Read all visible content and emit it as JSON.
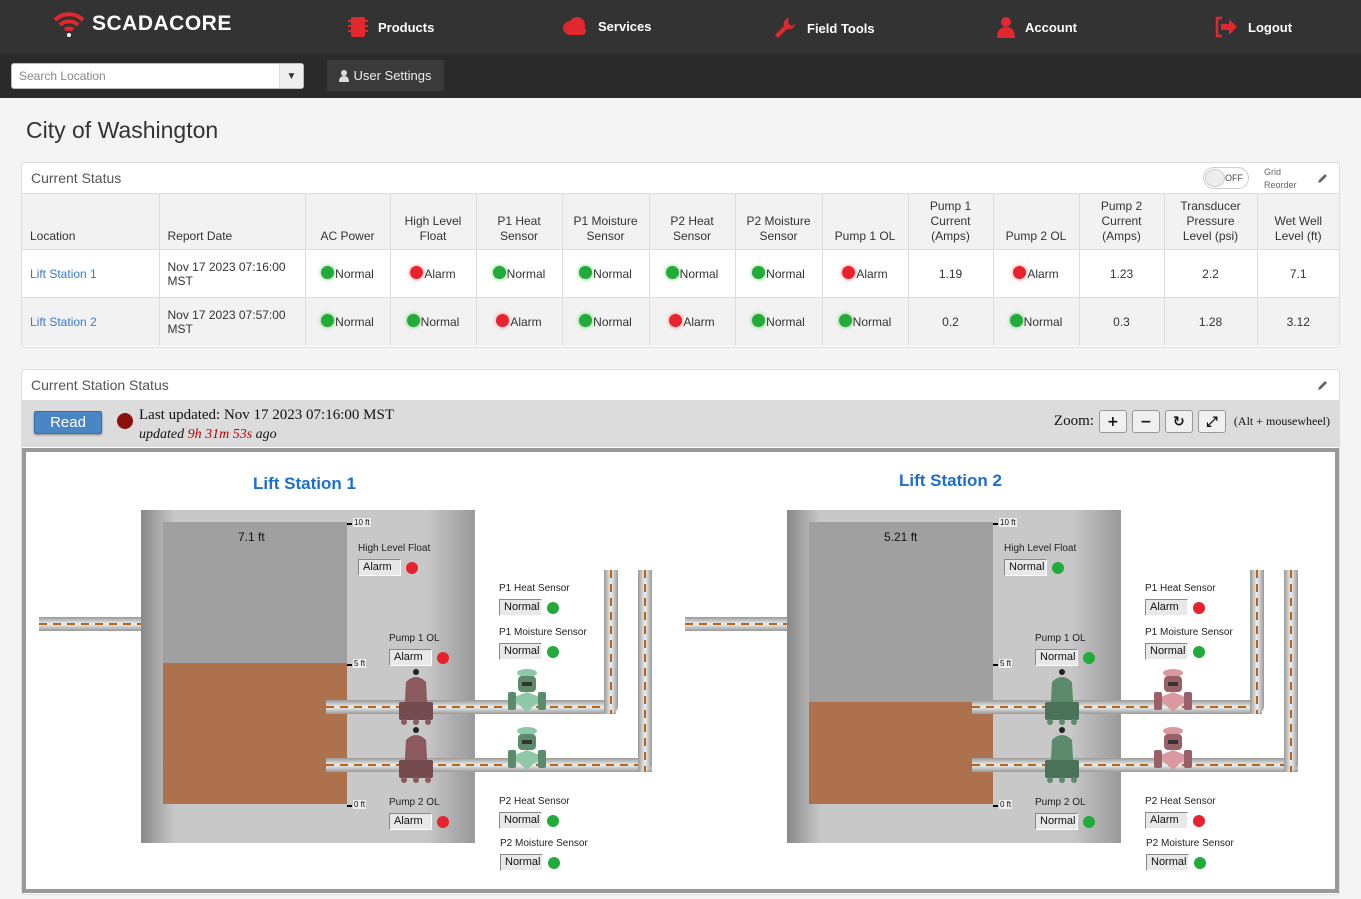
{
  "brand": {
    "name": "SCADACORE",
    "accent": "#e0282e"
  },
  "nav": [
    {
      "label": "Products",
      "icon": "chip-icon"
    },
    {
      "label": "Services",
      "icon": "cloud-icon"
    },
    {
      "label": "Field Tools",
      "icon": "wrench-icon"
    },
    {
      "label": "Account",
      "icon": "user-icon"
    },
    {
      "label": "Logout",
      "icon": "logout-icon"
    }
  ],
  "search": {
    "placeholder": "Search Location",
    "value": ""
  },
  "user_settings": "User Settings",
  "page_title": "City of Washington",
  "current_status": {
    "title": "Current Status",
    "toggle": "OFF",
    "grid_reorder": "Grid Reorder",
    "columns": [
      "Location",
      "Report Date",
      "AC Power",
      "High Level Float",
      "P1 Heat Sensor",
      "P1 Moisture Sensor",
      "P2 Heat Sensor",
      "P2 Moisture Sensor",
      "Pump 1 OL",
      "Pump 1 Current (Amps)",
      "Pump 2 OL",
      "Pump 2 Current (Amps)",
      "Transducer Pressure Level (psi)",
      "Wet Well Level (ft)"
    ],
    "rows": [
      {
        "location": "Lift Station 1",
        "date": "Nov 17 2023 07:16:00",
        "tz": "MST",
        "ac": "Normal",
        "hlf": "Alarm",
        "p1h": "Normal",
        "p1m": "Normal",
        "p2h": "Normal",
        "p2m": "Normal",
        "p1ol": "Alarm",
        "p1c": "1.19",
        "p2ol": "Alarm",
        "p2c": "1.23",
        "tp": "2.2",
        "wwl": "7.1"
      },
      {
        "location": "Lift Station 2",
        "date": "Nov 17 2023 07:57:00",
        "tz": "MST",
        "ac": "Normal",
        "hlf": "Normal",
        "p1h": "Alarm",
        "p1m": "Normal",
        "p2h": "Alarm",
        "p2m": "Normal",
        "p1ol": "Normal",
        "p1c": "0.2",
        "p2ol": "Normal",
        "p2c": "0.3",
        "tp": "1.28",
        "wwl": "3.12"
      }
    ]
  },
  "station_status": {
    "title": "Current Station Status",
    "read": "Read",
    "last_updated": "Last updated: Nov 17 2023 07:16:00 MST",
    "updated_prefix": "updated",
    "updated_time": "9h 31m 53s",
    "updated_suffix": "ago",
    "zoom_label": "Zoom:",
    "zoom_hint": "(Alt + mousewheel)",
    "zoom_buttons": [
      "+",
      "−",
      "↻",
      "⤢"
    ],
    "scale_ticks": [
      "10 ft",
      "5 ft",
      "0 ft"
    ],
    "stations": [
      {
        "name": "Lift Station 1",
        "level_label": "7.1 ft",
        "level_fraction": 0.5,
        "hlf": {
          "label": "High Level Float",
          "value": "Alarm"
        },
        "p1ol": {
          "label": "Pump 1 OL",
          "value": "Alarm"
        },
        "p2ol": {
          "label": "Pump 2 OL",
          "value": "Alarm"
        },
        "p1h": {
          "label": "P1 Heat Sensor",
          "value": "Normal"
        },
        "p1m": {
          "label": "P1 Moisture Sensor",
          "value": "Normal"
        },
        "p2h": {
          "label": "P2 Heat Sensor",
          "value": "Normal"
        },
        "p2m": {
          "label": "P2 Moisture Sensor",
          "value": "Normal"
        }
      },
      {
        "name": "Lift Station 2",
        "level_label": "5.21 ft",
        "level_fraction": 0.36,
        "hlf": {
          "label": "High Level Float",
          "value": "Normal"
        },
        "p1ol": {
          "label": "Pump 1 OL",
          "value": "Normal"
        },
        "p2ol": {
          "label": "Pump 2 OL",
          "value": "Normal"
        },
        "p1h": {
          "label": "P1 Heat Sensor",
          "value": "Alarm"
        },
        "p1m": {
          "label": "P1 Moisture Sensor",
          "value": "Normal"
        },
        "p2h": {
          "label": "P2 Heat Sensor",
          "value": "Alarm"
        },
        "p2m": {
          "label": "P2 Moisture Sensor",
          "value": "Normal"
        }
      }
    ]
  }
}
